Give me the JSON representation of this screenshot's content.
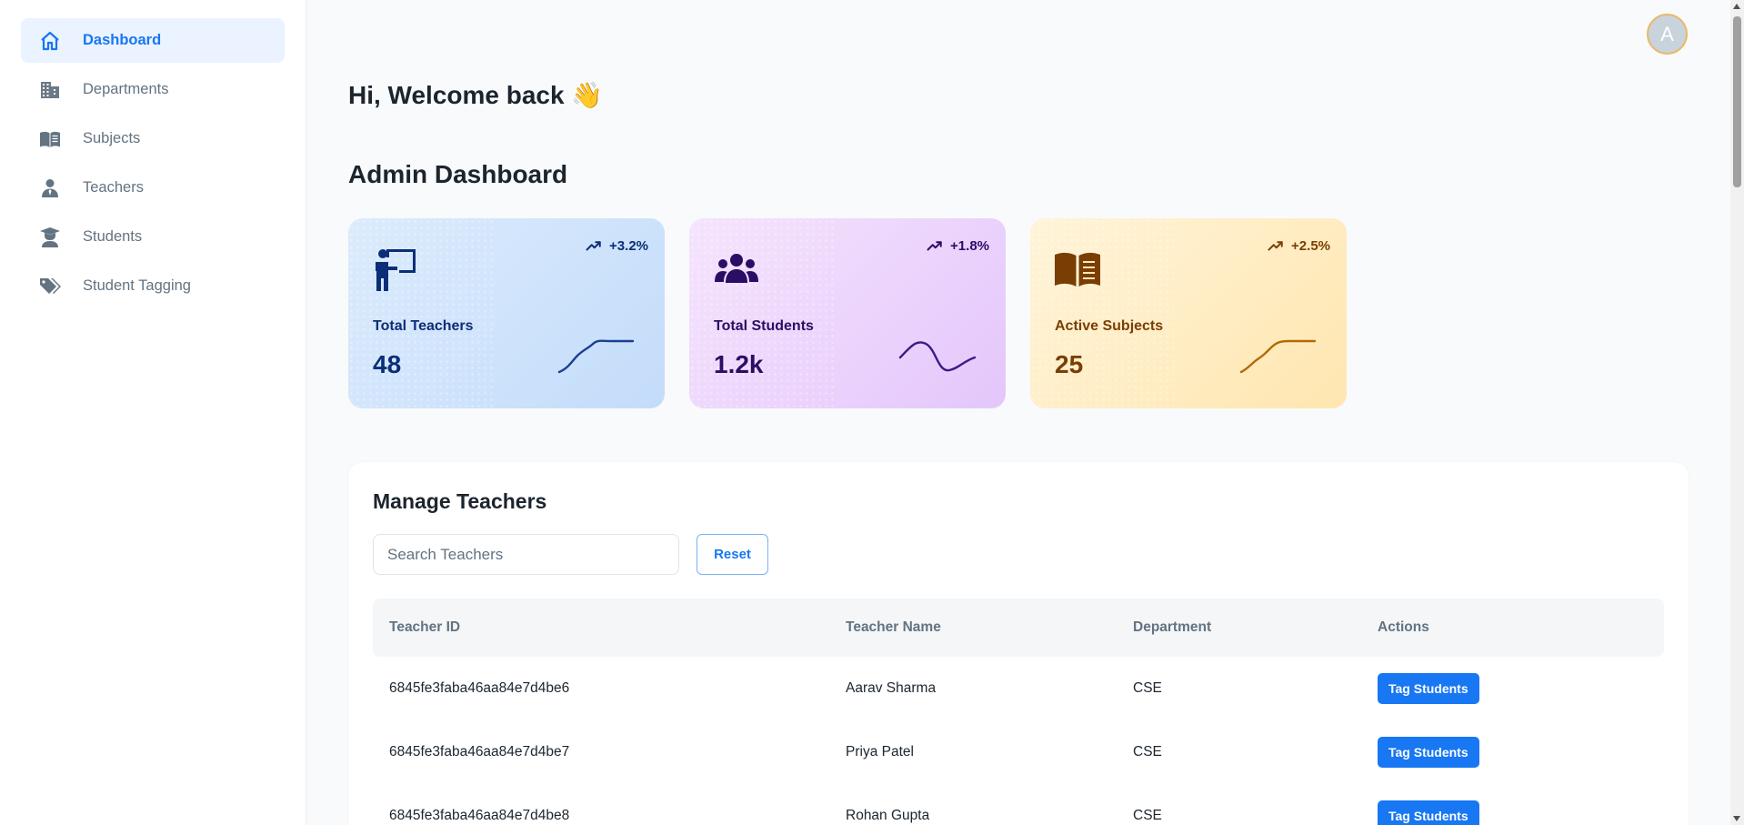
{
  "sidebar": {
    "items": [
      {
        "label": "Dashboard",
        "icon": "home-icon",
        "active": true
      },
      {
        "label": "Departments",
        "icon": "building-icon"
      },
      {
        "label": "Subjects",
        "icon": "book-icon"
      },
      {
        "label": "Teachers",
        "icon": "person-icon"
      },
      {
        "label": "Students",
        "icon": "student-icon"
      },
      {
        "label": "Student Tagging",
        "icon": "tags-icon"
      }
    ]
  },
  "header": {
    "avatar_letter": "A"
  },
  "main": {
    "greeting": "Hi, Welcome back 👋",
    "title": "Admin Dashboard"
  },
  "cards": [
    {
      "label": "Total Teachers",
      "value": "48",
      "trend": "+3.2%",
      "icon": "teacher-board-icon",
      "color": "#1e3f8f"
    },
    {
      "label": "Total Students",
      "value": "1.2k",
      "trend": "+1.8%",
      "icon": "users-group-icon",
      "color": "#3b1a86"
    },
    {
      "label": "Active Subjects",
      "value": "25",
      "trend": "+2.5%",
      "icon": "open-book-icon",
      "color": "#b46a06"
    }
  ],
  "teachers": {
    "title": "Manage Teachers",
    "search_placeholder": "Search Teachers",
    "reset_label": "Reset",
    "columns": [
      "Teacher ID",
      "Teacher Name",
      "Department",
      "Actions"
    ],
    "rows": [
      {
        "id": "6845fe3faba46aa84e7d4be6",
        "name": "Aarav Sharma",
        "department": "CSE",
        "action": "Tag Students"
      },
      {
        "id": "6845fe3faba46aa84e7d4be7",
        "name": "Priya Patel",
        "department": "CSE",
        "action": "Tag Students"
      },
      {
        "id": "6845fe3faba46aa84e7d4be8",
        "name": "Rohan Gupta",
        "department": "CSE",
        "action": "Tag Students"
      }
    ]
  },
  "colors": {
    "accent": "#1877f2",
    "active_nav_bg": "#eaf3ff"
  }
}
